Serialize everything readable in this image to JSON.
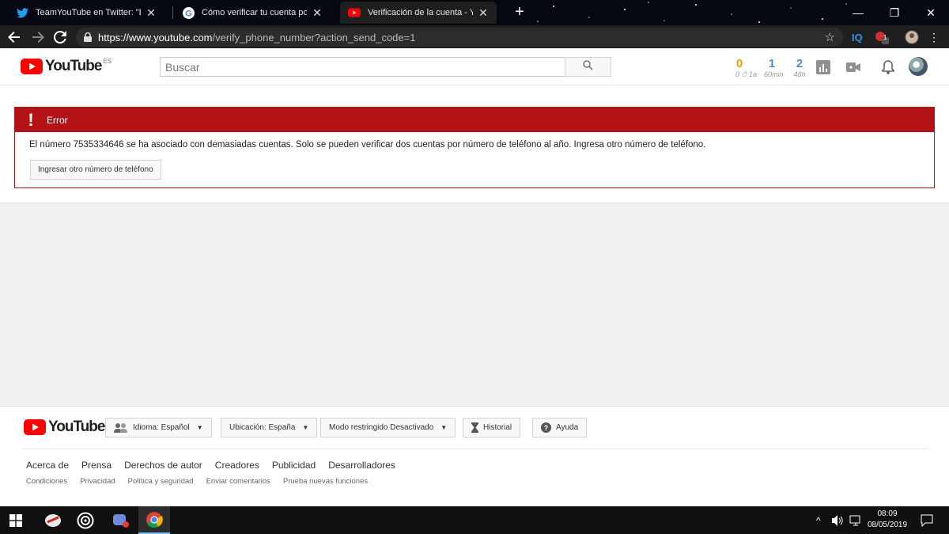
{
  "browser": {
    "tabs": [
      {
        "title": "TeamYouTube en Twitter: \"Enter",
        "close": "✕"
      },
      {
        "title": "Cómo verificar tu cuenta por telé",
        "close": "✕"
      },
      {
        "title": "Verificación de la cuenta - YouTu",
        "close": "✕"
      }
    ],
    "new_tab": "+",
    "url_host": "https://www.youtube.com",
    "url_path": "/verify_phone_number?action_send_code=1",
    "window_controls": {
      "minimize": "—",
      "maximize": "❐",
      "close": "✕"
    },
    "extension_badge": "1"
  },
  "header": {
    "logo_text": "YouTube",
    "logo_region": "ES",
    "search_placeholder": "Buscar",
    "stats": [
      {
        "value": "0",
        "label": "0 ⏱ 1a",
        "color": "#e6a100"
      },
      {
        "value": "1",
        "label": "60min",
        "color": "#4a90c8"
      },
      {
        "value": "2",
        "label": "48h",
        "color": "#4a90c8"
      }
    ]
  },
  "error": {
    "title": "Error",
    "icon": "!",
    "message": "El número 7535334646 se ha asociado con demasiadas cuentas. Solo se pueden verificar dos cuentas por número de teléfono al año. Ingresa otro número de teléfono.",
    "button": "Ingresar otro número de teléfono"
  },
  "footer": {
    "logo_text": "YouTube",
    "buttons": {
      "language": "Idioma: Español",
      "location": "Ubicación: España",
      "restricted": "Modo restringido Desactivado",
      "history": "Historial",
      "help": "Ayuda"
    },
    "primary_links": [
      "Acerca de",
      "Prensa",
      "Derechos de autor",
      "Creadores",
      "Publicidad",
      "Desarrolladores"
    ],
    "secondary_links": [
      "Condiciones",
      "Privacidad",
      "Política y seguridad",
      "Enviar comentarios",
      "Prueba nuevas funciones"
    ]
  },
  "taskbar": {
    "time": "08:09",
    "date": "08/05/2019"
  },
  "colors": {
    "error_red": "#b31217",
    "youtube_red": "#ff0000",
    "chrome_dark": "#1f1f1f"
  }
}
